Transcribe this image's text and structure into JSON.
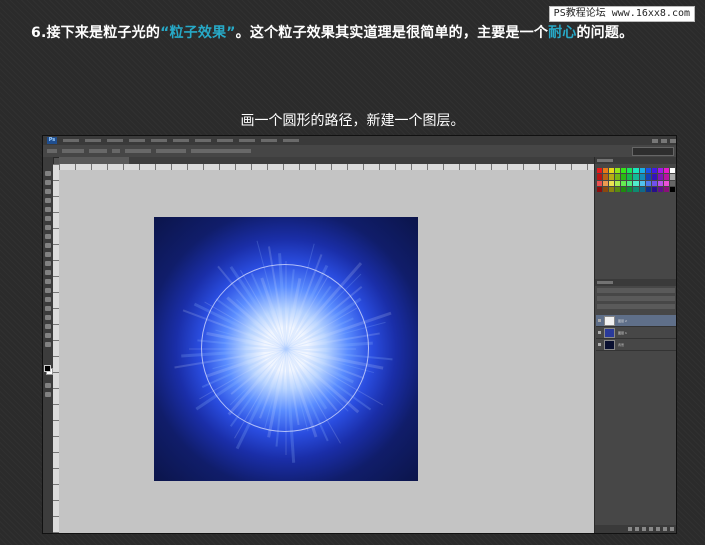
{
  "watermark": "PS教程论坛 www.16xx8.com",
  "heading": {
    "prefix": "6.接下来是粒子光的",
    "highlight1": "“粒子效果”",
    "middle": "。这个粒子效果其实道理是很简单的，主要是一个",
    "highlight2": "耐心",
    "suffix": "的问题。"
  },
  "caption": "画一个圆形的路径，新建一个图层。",
  "colors": {
    "highlight": "#27a9c7",
    "canvas_background": "#091240",
    "workspace": "#c4c4c4",
    "app_chrome": "#535353"
  },
  "photoshop": {
    "logo": "Ps",
    "layers": [
      {
        "name": "图层 2",
        "selected": true
      },
      {
        "name": "图层 1",
        "selected": false
      },
      {
        "name": "背景",
        "selected": false
      }
    ]
  }
}
